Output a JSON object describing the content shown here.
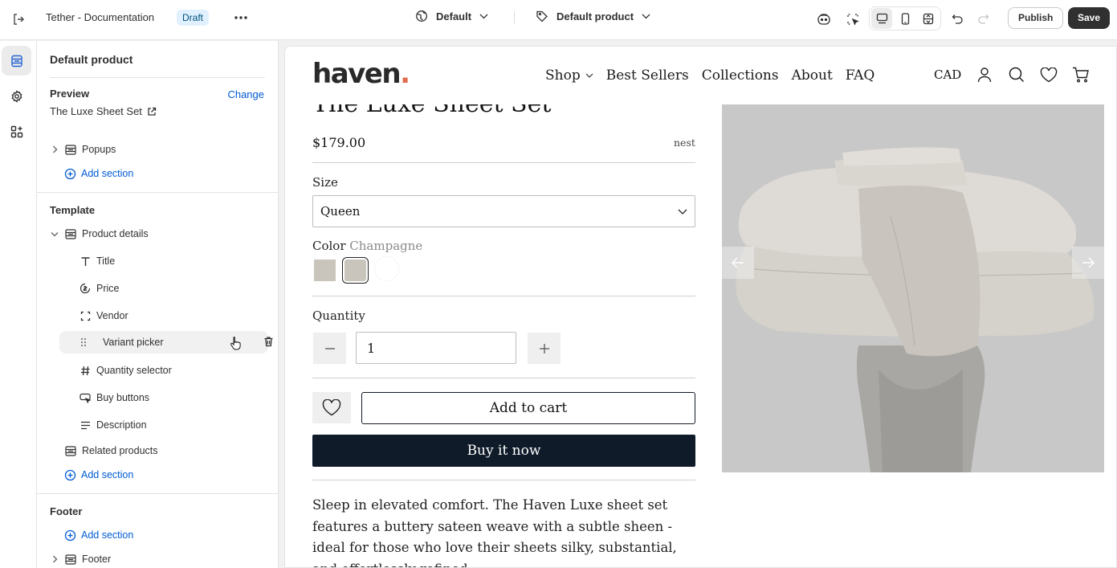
{
  "topbar": {
    "store_title": "Tether - Documentation",
    "status_badge": "Draft",
    "theme_label": "Default",
    "template_label": "Default product",
    "publish_label": "Publish",
    "save_label": "Save"
  },
  "sidebar": {
    "title": "Default product",
    "preview": {
      "label": "Preview",
      "change_label": "Change",
      "value": "The Luxe Sheet Set"
    },
    "header_group": {
      "items": [
        {
          "label": "Popups",
          "icon": "section-icon"
        }
      ],
      "add_label": "Add section"
    },
    "template": {
      "label": "Template",
      "section": "Product details",
      "blocks": [
        {
          "label": "Title",
          "icon": "text-icon"
        },
        {
          "label": "Price",
          "icon": "price-tag-icon"
        },
        {
          "label": "Vendor",
          "icon": "frame-icon"
        },
        {
          "label": "Variant picker",
          "icon": "drag-handle-icon"
        },
        {
          "label": "Quantity selector",
          "icon": "hash-icon"
        },
        {
          "label": "Buy buttons",
          "icon": "button-icon"
        },
        {
          "label": "Description",
          "icon": "paragraph-icon"
        }
      ],
      "related": "Related products",
      "add_label": "Add section"
    },
    "footer": {
      "label": "Footer",
      "add_label": "Add section",
      "item": "Footer"
    }
  },
  "store": {
    "logo_text": "haven",
    "logo_dot": ".",
    "nav": [
      "Shop",
      "Best Sellers",
      "Collections",
      "About",
      "FAQ"
    ],
    "currency": "CAD",
    "product_title": "The Luxe Sheet Set",
    "price": "$179.00",
    "vendor": "nest",
    "size_label": "Size",
    "size_value": "Queen",
    "color_label": "Color",
    "color_value": "Champagne",
    "quantity_label": "Quantity",
    "quantity_value": "1",
    "add_to_cart": "Add to cart",
    "buy_now": "Buy it now",
    "description": "Sleep in elevated comfort. The Haven Luxe sheet set features a buttery sateen weave with a subtle sheen - ideal for those who love their sheets silky, substantial, and effortlessly refined."
  },
  "colors": {
    "accent_link": "#005bd3",
    "save_bg": "#303030",
    "buy_now_bg": "#0f1b29",
    "logo_dot": "#e06a4c",
    "swatch_champagne": "#c9c5bd"
  }
}
